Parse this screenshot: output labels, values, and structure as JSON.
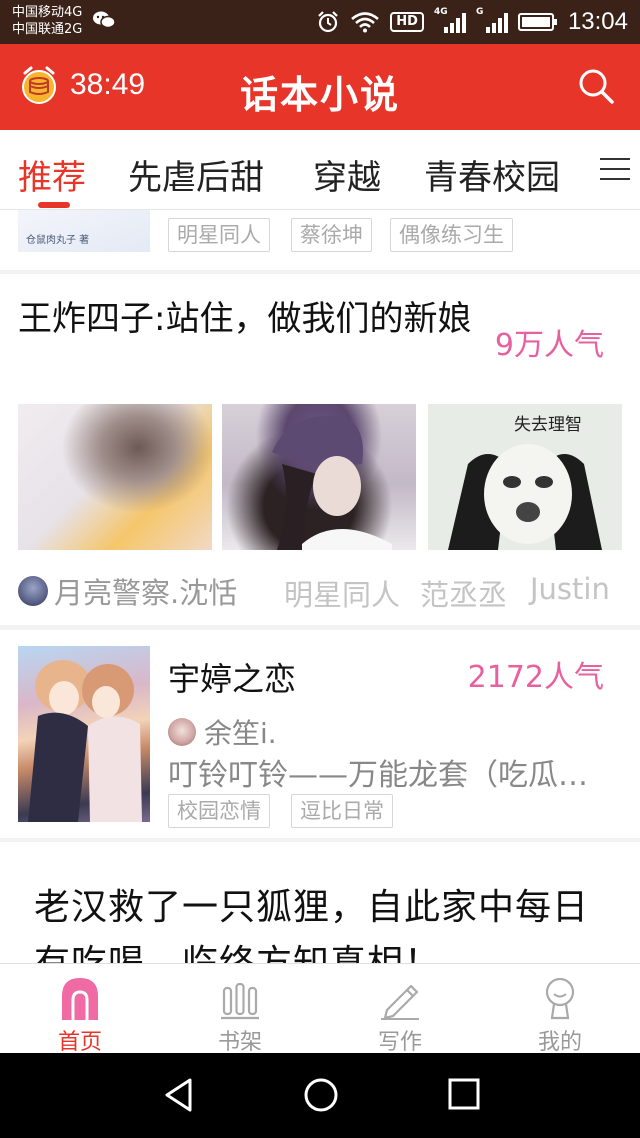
{
  "status_bar": {
    "carrier_1": "中国移动4G",
    "carrier_2": "中国联通2G",
    "hd": "HD",
    "net_1": "4G",
    "net_2": "G",
    "time": "13:04"
  },
  "header": {
    "timer": "38:49",
    "title": "话本小说",
    "accent_color": "#e8352a"
  },
  "tabs": [
    {
      "label": "推荐",
      "active": true
    },
    {
      "label": "先虐后甜",
      "active": false
    },
    {
      "label": "穿越",
      "active": false
    },
    {
      "label": "青春校园",
      "active": false
    }
  ],
  "feed": {
    "item1": {
      "cover_author_text": "仓鼠肉丸子 著",
      "tags": [
        "明星同人",
        "蔡徐坤",
        "偶像练习生"
      ]
    },
    "item2": {
      "title": "王炸四子:站住，做我们的新娘",
      "popularity": "9万人气",
      "image3_caption": "失去理智",
      "author": "月亮警察.沈恬",
      "tags": [
        "明星同人",
        "范丞丞",
        "Justin"
      ]
    },
    "item3": {
      "title": "宇婷之恋",
      "popularity": "2172人气",
      "author": "余笙i.",
      "summary": "叮铃叮铃——万能龙套（吃瓜群众）",
      "tags": [
        "校园恋情",
        "逗比日常"
      ]
    },
    "item4": {
      "title": "老汉救了一只狐狸，自此家中每日有吃喝，临终方知真相！"
    }
  },
  "bottom_nav": [
    {
      "label": "首页",
      "icon": "home-icon",
      "active": true
    },
    {
      "label": "书架",
      "icon": "bookshelf-icon",
      "active": false
    },
    {
      "label": "写作",
      "icon": "pencil-icon",
      "active": false
    },
    {
      "label": "我的",
      "icon": "profile-icon",
      "active": false
    }
  ],
  "colors": {
    "accent": "#e8352a",
    "popularity": "#e8609e"
  }
}
